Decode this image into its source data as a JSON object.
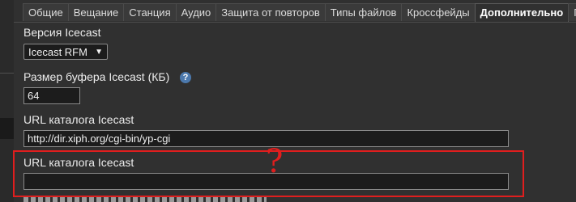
{
  "tabs": [
    {
      "label": "Общие",
      "active": false
    },
    {
      "label": "Вещание",
      "active": false
    },
    {
      "label": "Станция",
      "active": false
    },
    {
      "label": "Аудио",
      "active": false
    },
    {
      "label": "Защита от повторов",
      "active": false
    },
    {
      "label": "Типы файлов",
      "active": false
    },
    {
      "label": "Кроссфейды",
      "active": false
    },
    {
      "label": "Дополнительно",
      "active": true
    },
    {
      "label": "Пр",
      "active": false
    }
  ],
  "form": {
    "icecast_version": {
      "label": "Версия Icecast",
      "selected": "Icecast RFM"
    },
    "buffer_size": {
      "label": "Размер буфера Icecast (КБ)",
      "value": "64",
      "help_icon": "?"
    },
    "directory_url": {
      "label": "URL каталога Icecast",
      "value": "http://dir.xiph.org/cgi-bin/yp-cgi"
    },
    "directory_url_2": {
      "label": "URL каталога Icecast",
      "value": ""
    }
  },
  "annotation": {
    "mark": "?",
    "color": "#e01e1e"
  },
  "colors": {
    "background": "#303030",
    "tab_bg": "#3a3a3a",
    "input_bg": "#1c1c1c",
    "help_blue": "#4c79ad"
  }
}
